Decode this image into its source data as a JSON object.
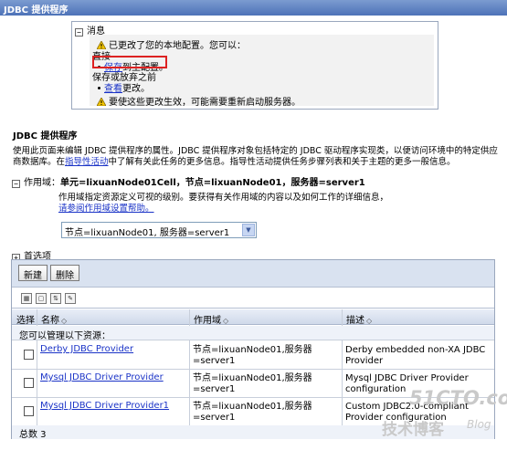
{
  "title": "JDBC 提供程序",
  "messages": {
    "header": "消息",
    "changed": "已更改了您的本地配置。您可以：",
    "direct": "直接",
    "save_link": "保存",
    "save_rest": "到主配置。",
    "discard": "保存或放弃之前",
    "review_link": "查看",
    "review_rest": "更改。",
    "restart": "要使这些更改生效，可能需要重新启动服务器。"
  },
  "section_title": "JDBC 提供程序",
  "description": {
    "line1": "使用此页面来编辑 JDBC 提供程序的属性。JDBC 提供程序对象包括特定的 JDBC 驱动程序实现类，以便访问环境中的特定供应",
    "line2a": "商数据库。在",
    "line2link": "指导性活动",
    "line2b": "中了解有关此任务的更多信息。指导性活动提供任务步骤列表和关于主题的更多一般信息。"
  },
  "scope": {
    "label": "作用域：",
    "value": "单元=lixuanNode01Cell，节点=lixuanNode01，服务器=server1",
    "desc": "作用域指定资源定义可视的级别。要获得有关作用域的内容以及如何工作的详细信息，",
    "help_link": "请参阅作用域设置帮助。",
    "select_value": "节点=lixuanNode01, 服务器=server1"
  },
  "preferences": "首选项",
  "toolbar": {
    "new_label": "新建",
    "delete_label": "删除"
  },
  "table": {
    "headers": {
      "select": "选择",
      "name": "名称",
      "scope": "作用域",
      "description": "描述"
    },
    "manage_label": "您可以管理以下资源：",
    "rows": [
      {
        "name": "Derby JDBC Provider",
        "scope_l1": "节点=lixuanNode01,服务器",
        "scope_l2": "=server1",
        "desc_l1": "Derby embedded non-XA JDBC",
        "desc_l2": "Provider"
      },
      {
        "name": "Mysql JDBC Driver Provider",
        "scope_l1": "节点=lixuanNode01,服务器",
        "scope_l2": "=server1",
        "desc_l1": "Mysql JDBC Driver Provider",
        "desc_l2": "configuration"
      },
      {
        "name": "Mysql JDBC Driver Provider1",
        "scope_l1": "节点=lixuanNode01,服务器",
        "scope_l2": "=server1",
        "desc_l1": "Custom JDBC2.0-compliant",
        "desc_l2": "Provider configuration"
      }
    ],
    "total": "总数 3"
  },
  "watermark": {
    "site": "51CTO.com",
    "blog_cn": "技术博客",
    "blog_en": "Blog"
  }
}
